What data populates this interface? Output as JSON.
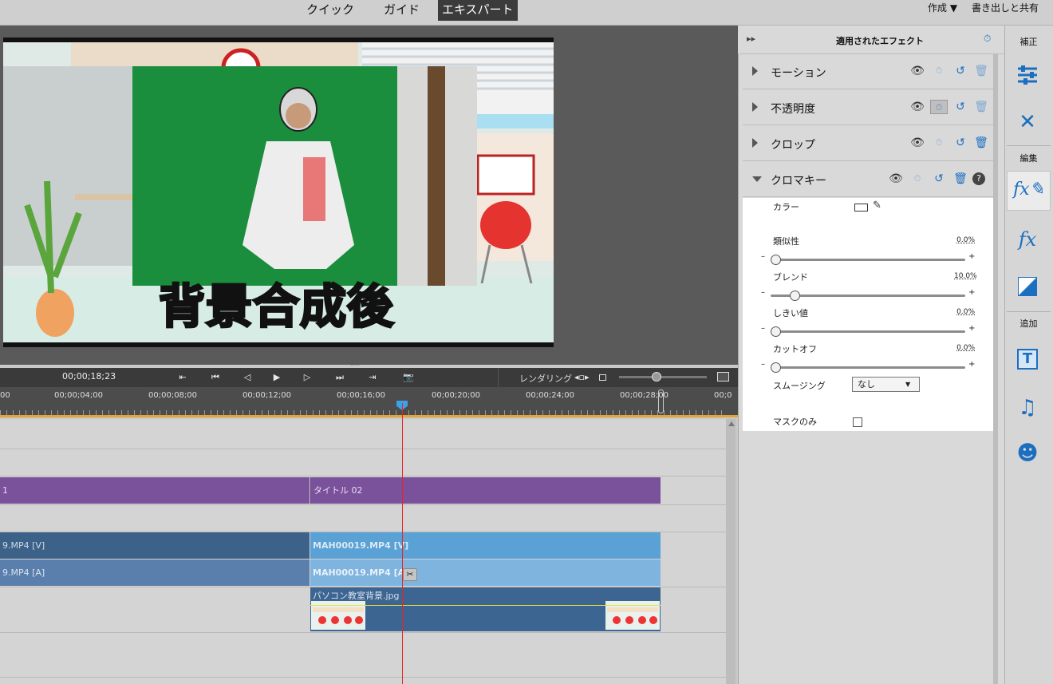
{
  "modes": [
    "クイック",
    "ガイド",
    "エキスパート"
  ],
  "top_right": {
    "create": "作成",
    "export": "書き出しと共有"
  },
  "video_caption": "背景合成後",
  "timecode": "00;00;18;23",
  "render_label": "レンダリング",
  "ruler_ticks": [
    "00",
    "00;00;04;00",
    "00;00;08;00",
    "00;00;12;00",
    "00;00;16;00",
    "00;00;20;00",
    "00;00;24;00",
    "00;00;28;00",
    "00;0"
  ],
  "tracks": {
    "title_left": "1",
    "title_clip": "タイトル 02",
    "video_left": "9.MP4 [V]",
    "video_clip": "MAH00019.MP4 [V]",
    "audio_left": "9.MP4 [A]",
    "audio_clip": "MAH00019.MP4 [A]",
    "image_clip": "パソコン教室背景.jpg"
  },
  "panel": {
    "title": "適用されたエフェクト",
    "effects": [
      "モーション",
      "不透明度",
      "クロップ",
      "クロマキー"
    ],
    "color_label": "カラー",
    "params": [
      {
        "label": "類似性",
        "value": "0.0",
        "unit": "%",
        "level": 0.0
      },
      {
        "label": "ブレンド",
        "value": "10.0",
        "unit": "%",
        "level": 0.1
      },
      {
        "label": "しきい値",
        "value": "0.0",
        "unit": "%",
        "level": 0.0
      },
      {
        "label": "カットオフ",
        "value": "0.0",
        "unit": "%",
        "level": 0.0
      }
    ],
    "minus": "–",
    "plus": "+",
    "smoothing_label": "スムージング",
    "smoothing_value": "なし",
    "mask_only": "マスクのみ"
  },
  "sidebar": {
    "adjust": "補正",
    "edit": "編集",
    "add": "追加",
    "fx": "fx",
    "text": "T"
  }
}
